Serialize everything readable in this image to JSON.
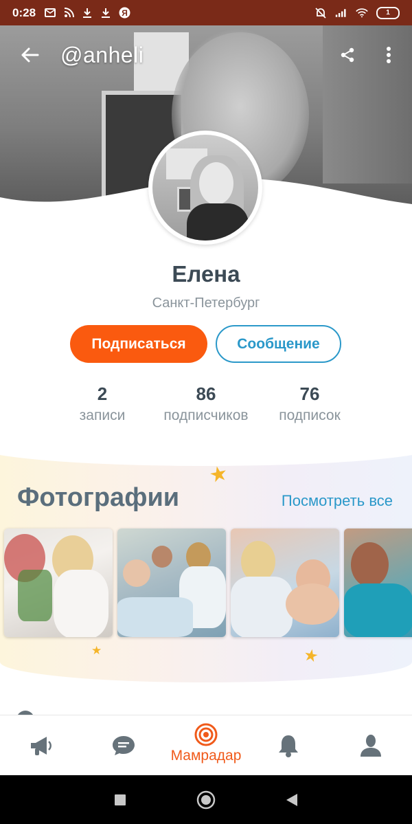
{
  "status_bar": {
    "time": "0:28",
    "battery": "1",
    "left_icons": [
      "mail-icon",
      "rss-icon",
      "download-icon",
      "download-icon",
      "yandex-icon"
    ],
    "right_icons": [
      "mute-icon",
      "signal-icon",
      "wifi-icon"
    ]
  },
  "profile": {
    "handle": "@anheli",
    "name": "Елена",
    "city": "Санкт-Петербург"
  },
  "actions": {
    "subscribe_label": "Подписаться",
    "message_label": "Сообщение"
  },
  "stats": [
    {
      "value": "2",
      "label": "записи"
    },
    {
      "value": "86",
      "label": "подписчиков"
    },
    {
      "value": "76",
      "label": "подписок"
    }
  ],
  "photos": {
    "title": "Фотографии",
    "see_all": "Посмотреть все"
  },
  "tabbar": {
    "tabs": [
      {
        "icon": "megaphone-icon"
      },
      {
        "icon": "chat-icon"
      },
      {
        "icon": "radar-icon",
        "label": "Мамрадар",
        "active": true
      },
      {
        "icon": "bell-icon"
      },
      {
        "icon": "profile-icon"
      }
    ]
  },
  "colors": {
    "accent_orange": "#fa5a0f",
    "accent_blue": "#2a98c9",
    "status_bar": "#7a2a18",
    "text_dark": "#3c4a55",
    "text_muted": "#8a949b"
  }
}
